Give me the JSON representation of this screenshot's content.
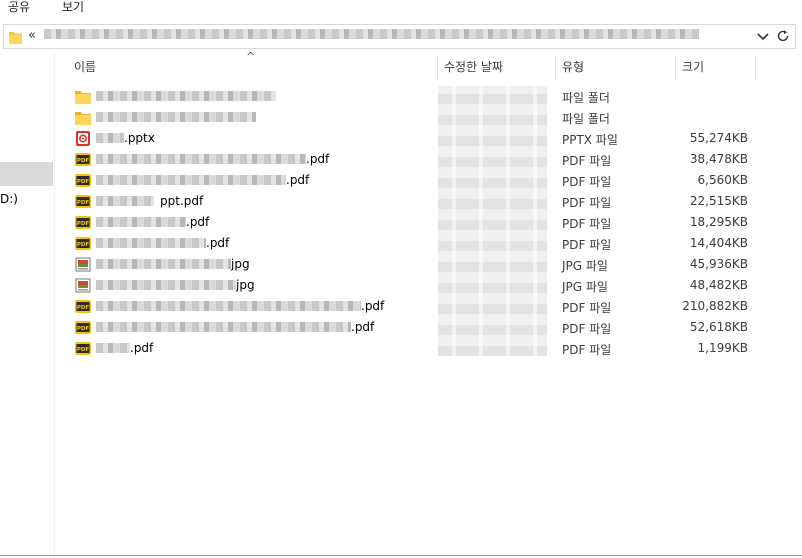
{
  "menu": {
    "share": "공유",
    "view": "보기"
  },
  "address": {
    "prefix": "«"
  },
  "nav": {
    "drive_label": "D:)"
  },
  "columns": {
    "name": "이름",
    "modified": "수정한 날짜",
    "type": "유형",
    "size": "크기"
  },
  "files": [
    {
      "icon": "folder-icon",
      "suffix": "",
      "type": "파일 폴더",
      "size": ""
    },
    {
      "icon": "folder-icon",
      "suffix": "",
      "type": "파일 폴더",
      "size": ""
    },
    {
      "icon": "pptx-icon",
      "suffix": ".pptx",
      "type": "PPTX 파일",
      "size": "55,274KB"
    },
    {
      "icon": "pdf-icon",
      "suffix": ".pdf",
      "type": "PDF 파일",
      "size": "38,478KB"
    },
    {
      "icon": "pdf-icon",
      "suffix": ".pdf",
      "type": "PDF 파일",
      "size": "6,560KB"
    },
    {
      "icon": "pdf-icon",
      "suffix": "ppt.pdf",
      "type": "PDF 파일",
      "size": "22,515KB"
    },
    {
      "icon": "pdf-icon",
      "suffix": ".pdf",
      "type": "PDF 파일",
      "size": "18,295KB"
    },
    {
      "icon": "pdf-icon",
      "suffix": ".pdf",
      "type": "PDF 파일",
      "size": "14,404KB"
    },
    {
      "icon": "jpg-icon",
      "suffix": "jpg",
      "type": "JPG 파일",
      "size": "45,936KB"
    },
    {
      "icon": "jpg-icon",
      "suffix": "jpg",
      "type": "JPG 파일",
      "size": "48,482KB"
    },
    {
      "icon": "pdf-icon",
      "suffix": ".pdf",
      "type": "PDF 파일",
      "size": "210,882KB"
    },
    {
      "icon": "pdf-icon",
      "suffix": ".pdf",
      "type": "PDF 파일",
      "size": "52,618KB"
    },
    {
      "icon": "pdf-icon",
      "suffix": ".pdf",
      "type": "PDF 파일",
      "size": "1,199KB"
    }
  ]
}
